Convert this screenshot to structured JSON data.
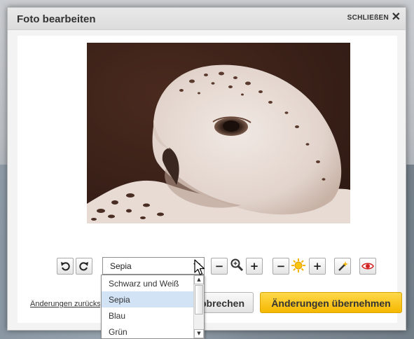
{
  "dialog": {
    "title": "Foto bearbeiten",
    "close_label": "SCHLIEßEN",
    "close_icon": "✕"
  },
  "toolbar": {
    "rotate_left_icon": "rotate-left-icon",
    "rotate_right_icon": "rotate-right-icon",
    "filter_select": {
      "value": "Sepia",
      "options": [
        "Schwarz und Weiß",
        "Sepia",
        "Blau",
        "Grün"
      ],
      "selected_index": 1
    },
    "zoom_minus": "−",
    "zoom_plus": "+",
    "brightness_minus": "−",
    "brightness_plus": "+",
    "colors": {
      "sun": "#f5b400",
      "eye": "#d21f1f",
      "magic": "#333333"
    }
  },
  "footer": {
    "undo_link": "Änderungen zurücksetzen",
    "cancel_button": "Abbrechen",
    "apply_button": "Änderungen übernehmen"
  },
  "colors": {
    "apply_button": "#f7c21a",
    "selected_option": "#d2e3f6"
  }
}
